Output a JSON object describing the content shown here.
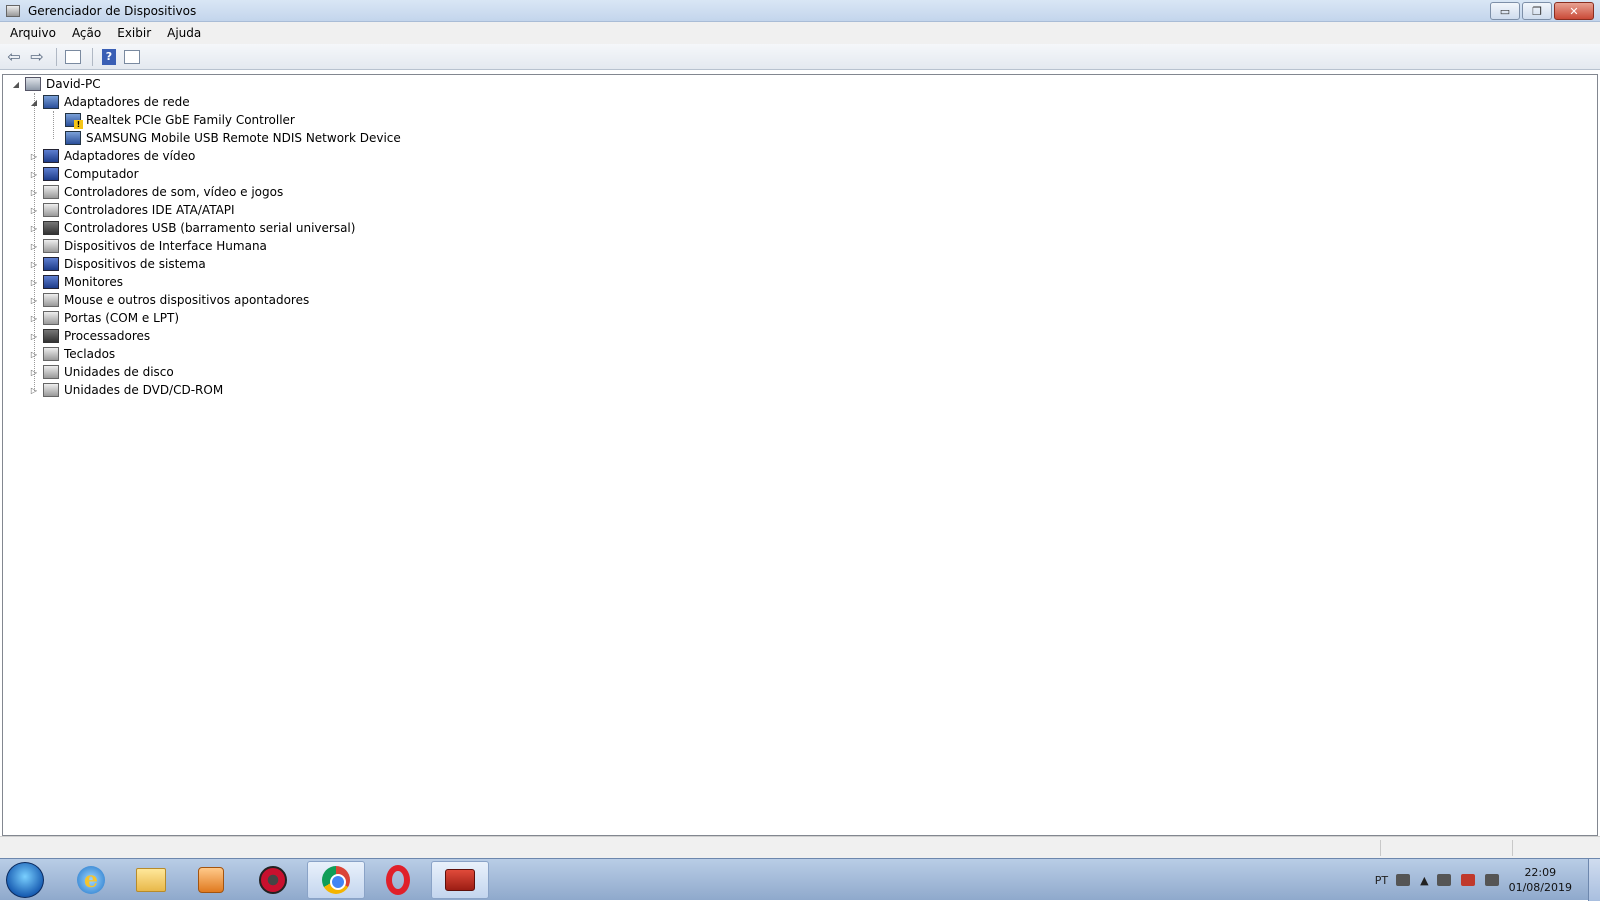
{
  "window": {
    "title": "Gerenciador de Dispositivos",
    "min_label": "▭",
    "max_label": "❐",
    "close_label": "✕"
  },
  "menu": {
    "items": [
      "Arquivo",
      "Ação",
      "Exibir",
      "Ajuda"
    ]
  },
  "toolbar": {
    "back_icon": "arrow-left-icon",
    "forward_icon": "arrow-right-icon",
    "help_label": "?"
  },
  "tree": {
    "root": "David-PC",
    "categories": [
      {
        "label": "Adaptadores de rede",
        "icon": "network-adapter-icon",
        "expanded": true,
        "children": [
          {
            "label": "Realtek PCIe GbE Family Controller",
            "warning": true
          },
          {
            "label": "SAMSUNG Mobile USB Remote NDIS Network Device",
            "warning": false
          }
        ]
      },
      {
        "label": "Adaptadores de vídeo",
        "icon": "display-adapter-icon"
      },
      {
        "label": "Computador",
        "icon": "computer-icon"
      },
      {
        "label": "Controladores de som, vídeo e jogos",
        "icon": "sound-icon"
      },
      {
        "label": "Controladores IDE ATA/ATAPI",
        "icon": "ide-icon"
      },
      {
        "label": "Controladores USB (barramento serial universal)",
        "icon": "usb-icon"
      },
      {
        "label": "Dispositivos de Interface Humana",
        "icon": "hid-icon"
      },
      {
        "label": "Dispositivos de sistema",
        "icon": "system-device-icon"
      },
      {
        "label": "Monitores",
        "icon": "monitor-icon"
      },
      {
        "label": "Mouse e outros dispositivos apontadores",
        "icon": "mouse-icon"
      },
      {
        "label": "Portas (COM e LPT)",
        "icon": "port-icon"
      },
      {
        "label": "Processadores",
        "icon": "processor-icon"
      },
      {
        "label": "Teclados",
        "icon": "keyboard-icon"
      },
      {
        "label": "Unidades de disco",
        "icon": "disk-drive-icon"
      },
      {
        "label": "Unidades de DVD/CD-ROM",
        "icon": "dvd-drive-icon"
      }
    ]
  },
  "taskbar": {
    "ie_letter": "e",
    "language": "PT",
    "time": "22:09",
    "date": "01/08/2019",
    "tray_arrow": "▲"
  }
}
